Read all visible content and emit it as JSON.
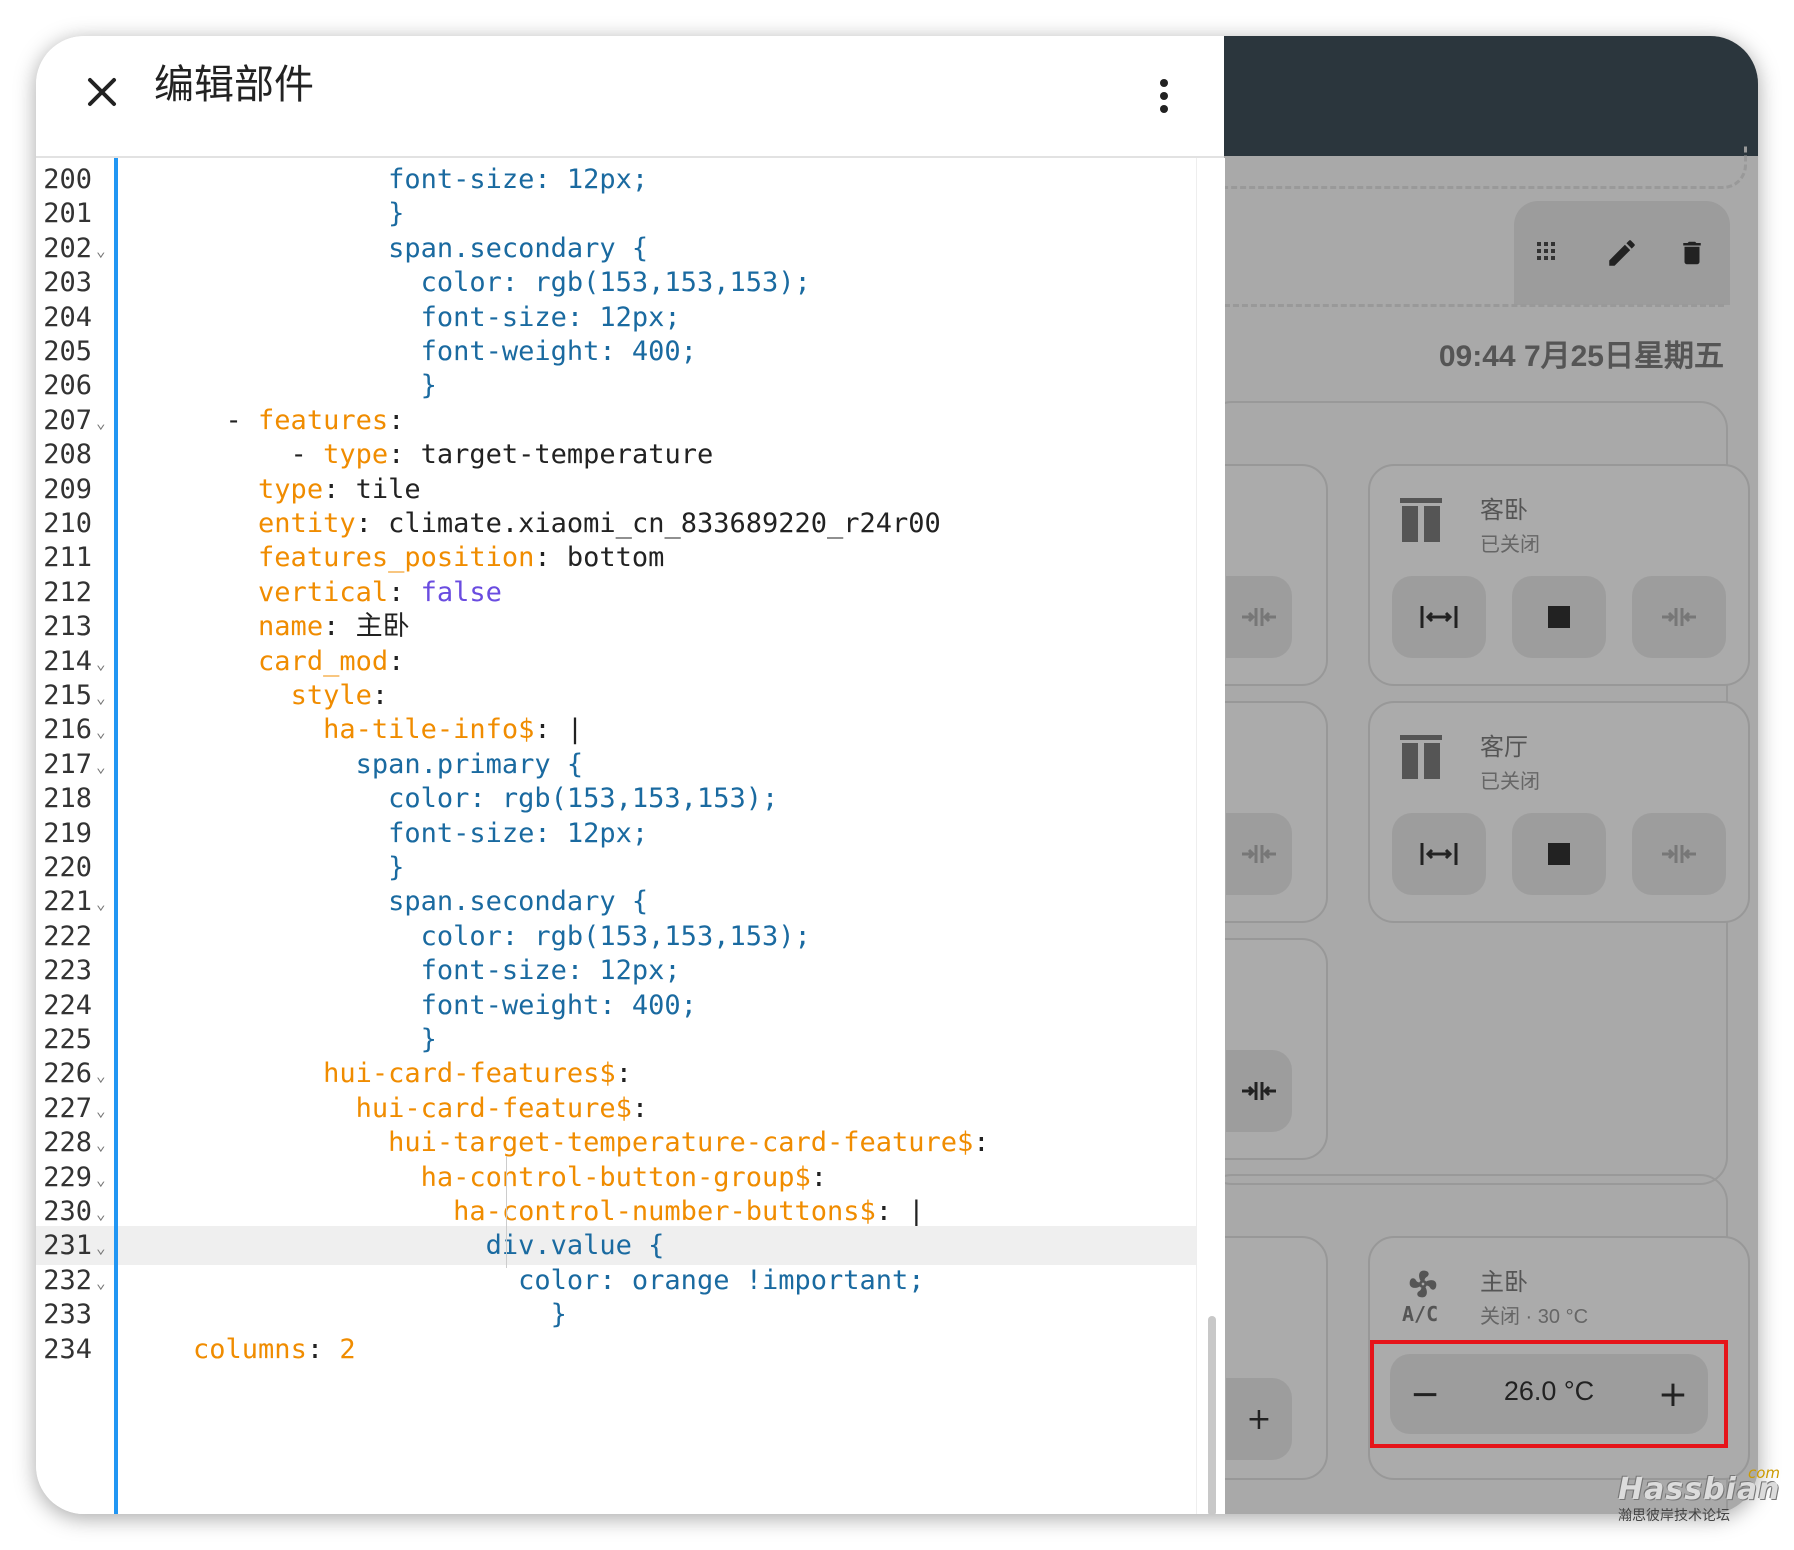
{
  "dialog": {
    "title": "编辑部件",
    "close_icon": "close-icon",
    "menu_icon": "more-vert-icon"
  },
  "code_lines": [
    {
      "n": "200",
      "fold": "",
      "parts": [
        [
          "s",
          "                font-size: 12px;"
        ]
      ]
    },
    {
      "n": "201",
      "fold": "",
      "parts": [
        [
          "s",
          "                }"
        ]
      ]
    },
    {
      "n": "202",
      "fold": "⌄",
      "parts": [
        [
          "s",
          "                span.secondary {"
        ]
      ]
    },
    {
      "n": "203",
      "fold": "",
      "parts": [
        [
          "s",
          "                  color: rgb(153,153,153);"
        ]
      ]
    },
    {
      "n": "204",
      "fold": "",
      "parts": [
        [
          "s",
          "                  font-size: 12px;"
        ]
      ]
    },
    {
      "n": "205",
      "fold": "",
      "parts": [
        [
          "s",
          "                  font-weight: 400;"
        ]
      ]
    },
    {
      "n": "206",
      "fold": "",
      "parts": [
        [
          "s",
          "                  }"
        ]
      ]
    },
    {
      "n": "207",
      "fold": "⌄",
      "parts": [
        [
          "p",
          "      - "
        ],
        [
          "k",
          "features"
        ],
        [
          "p",
          ":"
        ]
      ]
    },
    {
      "n": "208",
      "fold": "",
      "parts": [
        [
          "p",
          "          - "
        ],
        [
          "k",
          "type"
        ],
        [
          "p",
          ": "
        ],
        [
          "v",
          "target-temperature"
        ]
      ]
    },
    {
      "n": "209",
      "fold": "",
      "parts": [
        [
          "p",
          "        "
        ],
        [
          "k",
          "type"
        ],
        [
          "p",
          ": "
        ],
        [
          "v",
          "tile"
        ]
      ]
    },
    {
      "n": "210",
      "fold": "",
      "parts": [
        [
          "p",
          "        "
        ],
        [
          "k",
          "entity"
        ],
        [
          "p",
          ": "
        ],
        [
          "v",
          "climate.xiaomi_cn_833689220_r24r00"
        ]
      ]
    },
    {
      "n": "211",
      "fold": "",
      "parts": [
        [
          "p",
          "        "
        ],
        [
          "k",
          "features_position"
        ],
        [
          "p",
          ": "
        ],
        [
          "v",
          "bottom"
        ]
      ]
    },
    {
      "n": "212",
      "fold": "",
      "parts": [
        [
          "p",
          "        "
        ],
        [
          "k",
          "vertical"
        ],
        [
          "p",
          ": "
        ],
        [
          "b",
          "false"
        ]
      ]
    },
    {
      "n": "213",
      "fold": "",
      "parts": [
        [
          "p",
          "        "
        ],
        [
          "k",
          "name"
        ],
        [
          "p",
          ": "
        ],
        [
          "v",
          "主卧"
        ]
      ]
    },
    {
      "n": "214",
      "fold": "⌄",
      "parts": [
        [
          "p",
          "        "
        ],
        [
          "k",
          "card_mod"
        ],
        [
          "p",
          ":"
        ]
      ]
    },
    {
      "n": "215",
      "fold": "⌄",
      "parts": [
        [
          "p",
          "          "
        ],
        [
          "k",
          "style"
        ],
        [
          "p",
          ":"
        ]
      ]
    },
    {
      "n": "216",
      "fold": "⌄",
      "parts": [
        [
          "p",
          "            "
        ],
        [
          "k",
          "ha-tile-info$"
        ],
        [
          "p",
          ": |"
        ]
      ]
    },
    {
      "n": "217",
      "fold": "⌄",
      "parts": [
        [
          "s",
          "              span.primary {"
        ]
      ]
    },
    {
      "n": "218",
      "fold": "",
      "parts": [
        [
          "s",
          "                color: rgb(153,153,153);"
        ]
      ]
    },
    {
      "n": "219",
      "fold": "",
      "parts": [
        [
          "s",
          "                font-size: 12px;"
        ]
      ]
    },
    {
      "n": "220",
      "fold": "",
      "parts": [
        [
          "s",
          "                }"
        ]
      ]
    },
    {
      "n": "221",
      "fold": "⌄",
      "parts": [
        [
          "s",
          "                span.secondary {"
        ]
      ]
    },
    {
      "n": "222",
      "fold": "",
      "parts": [
        [
          "s",
          "                  color: rgb(153,153,153);"
        ]
      ]
    },
    {
      "n": "223",
      "fold": "",
      "parts": [
        [
          "s",
          "                  font-size: 12px;"
        ]
      ]
    },
    {
      "n": "224",
      "fold": "",
      "parts": [
        [
          "s",
          "                  font-weight: 400;"
        ]
      ]
    },
    {
      "n": "225",
      "fold": "",
      "parts": [
        [
          "s",
          "                  }"
        ]
      ]
    },
    {
      "n": "226",
      "fold": "⌄",
      "parts": [
        [
          "p",
          "            "
        ],
        [
          "k",
          "hui-card-features$"
        ],
        [
          "p",
          ":"
        ]
      ]
    },
    {
      "n": "227",
      "fold": "⌄",
      "parts": [
        [
          "p",
          "              "
        ],
        [
          "k",
          "hui-card-feature$"
        ],
        [
          "p",
          ":"
        ]
      ]
    },
    {
      "n": "228",
      "fold": "⌄",
      "parts": [
        [
          "p",
          "                "
        ],
        [
          "k",
          "hui-target-temperature-card-feature$"
        ],
        [
          "p",
          ":"
        ]
      ]
    },
    {
      "n": "229",
      "fold": "⌄",
      "parts": [
        [
          "p",
          "                  "
        ],
        [
          "k",
          "ha-control-button-group$"
        ],
        [
          "p",
          ":"
        ]
      ]
    },
    {
      "n": "230",
      "fold": "⌄",
      "parts": [
        [
          "p",
          "                    "
        ],
        [
          "k",
          "ha-control-number-buttons$"
        ],
        [
          "p",
          ": |"
        ]
      ]
    },
    {
      "n": "231",
      "fold": "⌄",
      "hl": true,
      "parts": [
        [
          "s",
          "                      div.value {"
        ]
      ]
    },
    {
      "n": "232",
      "fold": "⌄",
      "parts": [
        [
          "s",
          "                        color: orange !important;"
        ]
      ]
    },
    {
      "n": "233",
      "fold": "",
      "parts": [
        [
          "s",
          "                          }"
        ]
      ]
    },
    {
      "n": "234",
      "fold": "",
      "parts": [
        [
          "p",
          "    "
        ],
        [
          "k",
          "columns"
        ],
        [
          "p",
          ": "
        ],
        [
          "k",
          "2"
        ]
      ]
    }
  ],
  "dashboard": {
    "datetime": "09:44  7月25日星期五",
    "toolbar_icons": [
      "drag-grid-icon",
      "pencil-icon",
      "trash-icon"
    ],
    "cards": [
      {
        "name": "客卧",
        "state": "已关闭"
      },
      {
        "name": "客厅",
        "state": "已关闭"
      }
    ],
    "climate": {
      "name": "主卧",
      "state": "关闭 · 30 °C",
      "icon_text": "A/C",
      "minus": "−",
      "plus": "+",
      "value": "26.0 °C"
    },
    "partial_plus": "+"
  },
  "watermark": {
    "brand": "Hassbian",
    "com": "com",
    "sub": "瀚思彼岸技术论坛"
  },
  "colors": {
    "key": "#f08c00",
    "string": "#1a6aa0",
    "bool": "#6a4ce0",
    "accent_bar": "#2196f3",
    "highlight_box": "#e6141a"
  }
}
